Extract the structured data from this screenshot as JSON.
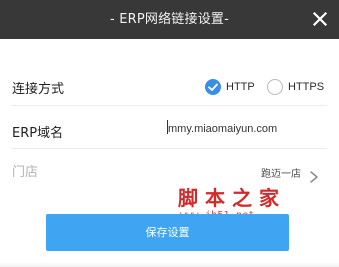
{
  "window": {
    "title": "- ERP网络链接设置-",
    "close_icon": "close-icon"
  },
  "form": {
    "connection": {
      "label": "连接方式",
      "options": [
        {
          "label": "HTTP",
          "selected": true
        },
        {
          "label": "HTTPS",
          "selected": false
        }
      ]
    },
    "domain": {
      "label": "ERP域名",
      "value": "mmy.miaomaiyun.com"
    },
    "store": {
      "label": "门店",
      "value": "跑迈一店",
      "chevron_icon": "chevron-right-icon"
    }
  },
  "watermark": {
    "text": "脚本之家",
    "url": "www.jb51.net"
  },
  "actions": {
    "save_label": "保存设置"
  },
  "colors": {
    "titlebar": "#383838",
    "accent": "#3fa5f2",
    "radio_checked": "#3a8ee6",
    "watermark": "#d22a2a"
  }
}
